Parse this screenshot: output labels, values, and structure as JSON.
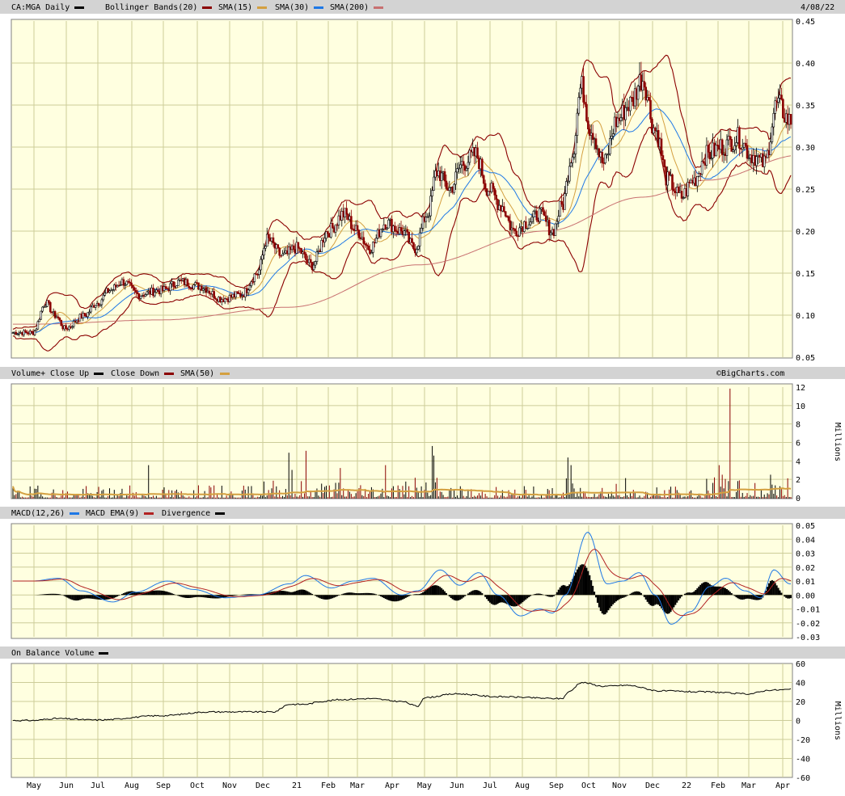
{
  "header": {
    "symbol_label": "CA:MGA Daily",
    "bb_label": "Bollinger Bands(20)",
    "sma15_label": "SMA(15)",
    "sma30_label": "SMA(30)",
    "sma200_label": "SMA(200)",
    "date_label": "4/08/22"
  },
  "volume_header": {
    "vol_label": "Volume+",
    "up_label": "Close Up",
    "down_label": "Close Down",
    "sma_label": "SMA(50)",
    "credit": "©BigCharts.com"
  },
  "macd_header": {
    "macd_label": "MACD(12,26)",
    "ema_label": "MACD EMA(9)",
    "div_label": "Divergence"
  },
  "obv_header": {
    "obv_label": "On Balance Volume"
  },
  "colors": {
    "up": "#000000",
    "down": "#8b0000",
    "bollinger": "#8b0000",
    "sma15": "#d4a040",
    "sma30": "#1e78e6",
    "sma200": "#c87070",
    "vol_sma": "#d4a040",
    "macd": "#1e78e6",
    "macd_ema": "#b22222"
  },
  "chart_data": [
    {
      "type": "candlestick",
      "panel": "price",
      "y_range": [
        0.05,
        0.45
      ],
      "y_ticks": [
        "0.05",
        "0.10",
        "0.15",
        "0.20",
        "0.25",
        "0.30",
        "0.35",
        "0.40",
        "0.45"
      ],
      "x_labels": [
        "May",
        "Jun",
        "Jul",
        "Aug",
        "Sep",
        "Oct",
        "Nov",
        "Dec",
        "21",
        "Feb",
        "Mar",
        "Apr",
        "May",
        "Jun",
        "Jul",
        "Aug",
        "Sep",
        "Oct",
        "Nov",
        "Dec",
        "22",
        "Feb",
        "Mar",
        "Apr"
      ],
      "close_anchors": [
        [
          0,
          0.08
        ],
        [
          0.4,
          0.115
        ],
        [
          0.7,
          0.1
        ],
        [
          1.0,
          0.085
        ],
        [
          1.6,
          0.1
        ],
        [
          2.0,
          0.115
        ],
        [
          2.4,
          0.13
        ],
        [
          2.8,
          0.14
        ],
        [
          3.3,
          0.125
        ],
        [
          4.0,
          0.13
        ],
        [
          4.6,
          0.14
        ],
        [
          5.2,
          0.135
        ],
        [
          5.9,
          0.12
        ],
        [
          6.5,
          0.125
        ],
        [
          7.0,
          0.15
        ],
        [
          7.3,
          0.19
        ],
        [
          7.8,
          0.17
        ],
        [
          8.2,
          0.18
        ],
        [
          8.7,
          0.16
        ],
        [
          9.2,
          0.2
        ],
        [
          9.7,
          0.22
        ],
        [
          10.1,
          0.2
        ],
        [
          10.5,
          0.18
        ],
        [
          11.0,
          0.21
        ],
        [
          11.5,
          0.2
        ],
        [
          11.9,
          0.18
        ],
        [
          12.3,
          0.22
        ],
        [
          12.6,
          0.27
        ],
        [
          13.0,
          0.25
        ],
        [
          13.4,
          0.28
        ],
        [
          13.8,
          0.29
        ],
        [
          14.2,
          0.25
        ],
        [
          14.6,
          0.23
        ],
        [
          15.0,
          0.2
        ],
        [
          15.4,
          0.21
        ],
        [
          15.8,
          0.22
        ],
        [
          16.2,
          0.2
        ],
        [
          16.5,
          0.23
        ],
        [
          16.8,
          0.29
        ],
        [
          17.1,
          0.37
        ],
        [
          17.4,
          0.32
        ],
        [
          17.8,
          0.28
        ],
        [
          18.2,
          0.33
        ],
        [
          18.6,
          0.35
        ],
        [
          19.0,
          0.38
        ],
        [
          19.4,
          0.32
        ],
        [
          19.8,
          0.26
        ],
        [
          20.2,
          0.24
        ],
        [
          20.6,
          0.26
        ],
        [
          21.0,
          0.29
        ],
        [
          21.5,
          0.3
        ],
        [
          22.0,
          0.31
        ],
        [
          22.4,
          0.29
        ],
        [
          22.8,
          0.28
        ],
        [
          23.2,
          0.35
        ],
        [
          23.6,
          0.33
        ],
        [
          24.0,
          0.34
        ]
      ],
      "sma200_anchors": [
        [
          0,
          0.09
        ],
        [
          4,
          0.095
        ],
        [
          8,
          0.11
        ],
        [
          12,
          0.16
        ],
        [
          16,
          0.2
        ],
        [
          19,
          0.24
        ],
        [
          21,
          0.26
        ],
        [
          24,
          0.29
        ]
      ]
    },
    {
      "type": "bar",
      "panel": "volume",
      "unit": "Millions",
      "y_range": [
        0,
        12
      ],
      "y_ticks": [
        "0",
        "2",
        "4",
        "6",
        "8",
        "10",
        "12"
      ],
      "spikes": [
        [
          3.6,
          3.5
        ],
        [
          8.0,
          4.8
        ],
        [
          8.1,
          3.0
        ],
        [
          8.5,
          5.0
        ],
        [
          9.6,
          3.2
        ],
        [
          11.0,
          3.5
        ],
        [
          12.45,
          5.5
        ],
        [
          12.5,
          4.5
        ],
        [
          16.7,
          4.3
        ],
        [
          16.8,
          3.5
        ],
        [
          21.4,
          3.5
        ],
        [
          21.5,
          2.5
        ],
        [
          21.75,
          11.5
        ],
        [
          23.0,
          2.5
        ]
      ]
    },
    {
      "type": "line",
      "panel": "macd",
      "y_range": [
        -0.03,
        0.05
      ],
      "y_ticks": [
        "0.05",
        "0.04",
        "0.03",
        "0.02",
        "0.01",
        "0.00",
        "-0.01",
        "-0.02",
        "-0.03"
      ],
      "macd_anchors": [
        [
          0,
          0.01
        ],
        [
          0.8,
          0.012
        ],
        [
          1.5,
          0.003
        ],
        [
          2.5,
          -0.005
        ],
        [
          3.2,
          0.002
        ],
        [
          4.2,
          0.01
        ],
        [
          5.0,
          0.004
        ],
        [
          6.0,
          -0.002
        ],
        [
          7.0,
          0.0
        ],
        [
          8.0,
          0.008
        ],
        [
          8.5,
          0.014
        ],
        [
          9.3,
          0.005
        ],
        [
          10.0,
          0.01
        ],
        [
          10.6,
          0.012
        ],
        [
          11.5,
          0.0
        ],
        [
          12.0,
          0.003
        ],
        [
          12.7,
          0.018
        ],
        [
          13.3,
          0.007
        ],
        [
          13.9,
          0.016
        ],
        [
          14.5,
          0.0
        ],
        [
          15.2,
          -0.015
        ],
        [
          15.8,
          -0.01
        ],
        [
          16.2,
          -0.013
        ],
        [
          16.6,
          0.0
        ],
        [
          17.3,
          0.045
        ],
        [
          17.9,
          0.008
        ],
        [
          18.4,
          0.01
        ],
        [
          18.9,
          0.016
        ],
        [
          19.4,
          0.0
        ],
        [
          19.9,
          -0.021
        ],
        [
          20.5,
          -0.012
        ],
        [
          21.1,
          0.006
        ],
        [
          21.6,
          0.012
        ],
        [
          22.2,
          0.003
        ],
        [
          22.7,
          -0.002
        ],
        [
          23.1,
          0.018
        ],
        [
          23.6,
          0.008
        ],
        [
          24,
          0.006
        ]
      ]
    },
    {
      "type": "line",
      "panel": "obv",
      "unit": "Millions",
      "y_range": [
        -60,
        60
      ],
      "y_ticks": [
        "60",
        "40",
        "20",
        "0",
        "-20",
        "-40",
        "-60"
      ],
      "obv_anchors": [
        [
          0,
          0
        ],
        [
          0.7,
          2
        ],
        [
          2,
          0.5
        ],
        [
          4,
          5
        ],
        [
          5.5,
          9
        ],
        [
          7.5,
          9
        ],
        [
          8.0,
          17
        ],
        [
          8.5,
          17
        ],
        [
          9.0,
          20
        ],
        [
          9.6,
          22
        ],
        [
          10.5,
          23
        ],
        [
          11.5,
          20
        ],
        [
          12.0,
          15
        ],
        [
          12.2,
          24
        ],
        [
          13.2,
          28
        ],
        [
          14.5,
          25
        ],
        [
          16.5,
          23
        ],
        [
          16.7,
          30
        ],
        [
          17.1,
          40
        ],
        [
          17.8,
          36
        ],
        [
          18.5,
          37
        ],
        [
          19.6,
          31
        ],
        [
          21.0,
          30
        ],
        [
          22.3,
          28
        ],
        [
          23.0,
          32
        ],
        [
          24,
          33
        ]
      ]
    }
  ]
}
